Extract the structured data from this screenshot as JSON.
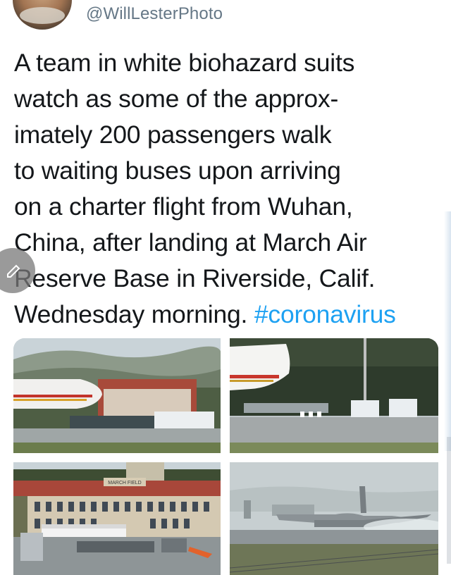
{
  "tweet": {
    "handle": "@WillLesterPhoto",
    "text_lines": [
      "A team in white biohazard suits",
      "watch as some of the approx-",
      "imately 200 passengers walk",
      "to waiting buses upon arriving",
      "on a charter flight from Wuhan,",
      "China, after landing at March Air",
      "Reserve Base in Riverside, Calif.",
      "Wednesday morning. "
    ],
    "hashtag": "#coronavirus"
  },
  "photos": [
    {
      "alt": "aircraft-and-buses"
    },
    {
      "alt": "passengers-near-buses"
    },
    {
      "alt": "hangar-building",
      "sign_text": "MARCH FIELD"
    },
    {
      "alt": "jet-landing"
    }
  ],
  "colors": {
    "text": "#14171a",
    "secondary": "#657786",
    "link": "#1da1f2"
  }
}
